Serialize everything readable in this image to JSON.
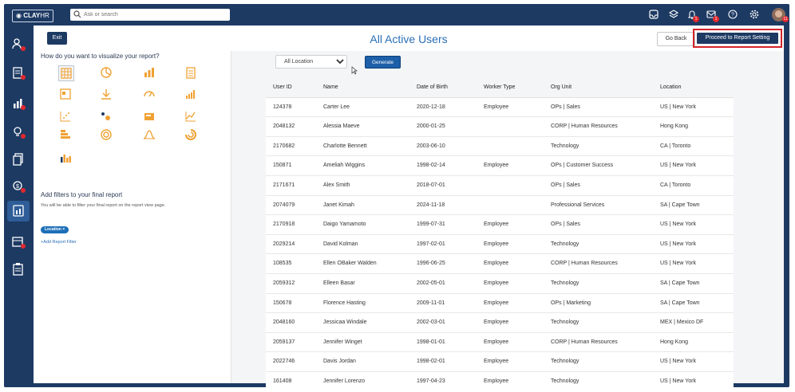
{
  "brand": {
    "logo_text": "CLAY",
    "logo_suffix": "HR"
  },
  "search": {
    "placeholder": "Ask or search"
  },
  "topbar": {
    "notification_count": "1",
    "message_count": "1",
    "avatar_badge": "11"
  },
  "header": {
    "exit_label": "Exit",
    "title": "All Active Users",
    "go_back_label": "Go Back",
    "proceed_label": "Proceed to Report Setting"
  },
  "visualize": {
    "prompt": "How do you want to visualize your report?",
    "icons": [
      "table-icon",
      "pie-chart-icon",
      "bar-chart-icon",
      "document-icon",
      "list-doc-icon",
      "download-icon",
      "gauge-icon",
      "column-chart-icon",
      "scatter-icon",
      "bubble-icon",
      "card-icon",
      "line-chart-icon",
      "stacked-bar-icon",
      "donut-icon",
      "bell-curve-icon",
      "radial-icon",
      "waterfall-icon"
    ]
  },
  "filters": {
    "title": "Add filters to your final report",
    "description": "You will be able to filter your final report on the report view page.",
    "chip_label": "Location",
    "add_label": "+Add Report Filter"
  },
  "controls": {
    "location_select": "All Location",
    "generate_label": "Generate"
  },
  "table": {
    "columns": [
      "User ID",
      "Name",
      "Date of Birth",
      "Worker Type",
      "Org Unit",
      "Location"
    ],
    "rows": [
      [
        "124378",
        "Carter Lee",
        "2020-12-18",
        "Employee",
        "OPs | Sales",
        "US | New York"
      ],
      [
        "2048132",
        "Alessia Maeve",
        "2000-01-25",
        "",
        "CORP | Human Resources",
        "Hong Kong"
      ],
      [
        "2170682",
        "Charlotte Bennett",
        "2003-06-10",
        "",
        "Technology",
        "CA | Toronto"
      ],
      [
        "150871",
        "Ameliah Wiggins",
        "1998-02-14",
        "Employee",
        "OPs | Customer Success",
        "US | New York"
      ],
      [
        "2171671",
        "Alex Smith",
        "2018-07-01",
        "",
        "OPs | Sales",
        "CA | Toronto"
      ],
      [
        "2074079",
        "Janet Kimah",
        "2024-11-18",
        "",
        "Professional Services",
        "SA | Cape Town"
      ],
      [
        "2170918",
        "Daigo Yamamoto",
        "1999-07-31",
        "Employee",
        "OPs | Sales",
        "US | New York"
      ],
      [
        "2029214",
        "David Kolman",
        "1997-02-01",
        "Employee",
        "Technology",
        "US | New York"
      ],
      [
        "108535",
        "Ellen OBaker Walden",
        "1996-06-25",
        "Employee",
        "CORP | Human Resources",
        "US | New York"
      ],
      [
        "2059312",
        "Elleen Basar",
        "2002-05-01",
        "Employee",
        "Technology",
        "SA | Cape Town"
      ],
      [
        "150678",
        "Florence Hasting",
        "2009-11-01",
        "Employee",
        "OPs | Marketing",
        "SA | Cape Town"
      ],
      [
        "2048160",
        "Jessicaa Windale",
        "2002-03-01",
        "Employee",
        "Technology",
        "MEX | Mexico DF"
      ],
      [
        "2059137",
        "Jennifer Winget",
        "1998-01-01",
        "Employee",
        "CORP | Human Resources",
        "Hong Kong"
      ],
      [
        "2022746",
        "Davis Jordan",
        "1998-02-01",
        "Employee",
        "Technology",
        "US | New York"
      ],
      [
        "161408",
        "Jennifer Lorenzo",
        "1997-04-23",
        "Employee",
        "Technology",
        "US | New York"
      ]
    ]
  },
  "colors": {
    "navy": "#1d3a63",
    "accent": "#2b6fb8",
    "orange": "#f0a133",
    "highlight": "#d2242a"
  }
}
